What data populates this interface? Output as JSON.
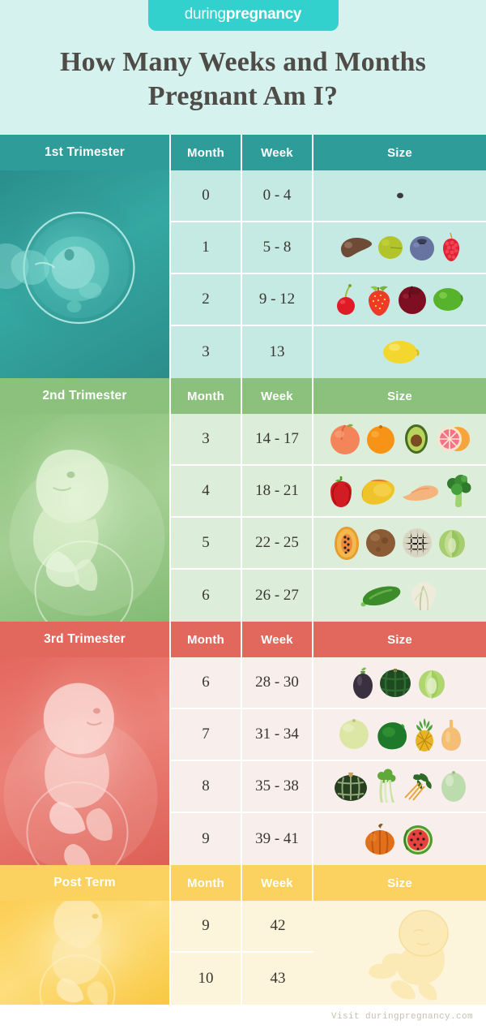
{
  "brand": {
    "logo_light": "during",
    "logo_bold": "pregnancy",
    "badge_color": "#33D1CD"
  },
  "title": "How Many Weeks and Months Pregnant Am I?",
  "columns": {
    "month": "Month",
    "week": "Week",
    "size": "Size"
  },
  "footer": {
    "text": "Visit duringpregnancy.com"
  },
  "sections": [
    {
      "name": "1st Trimester",
      "header_color": "#2E9D99",
      "body_color": "#C5E9E3",
      "image": "embryo-illustration-teal",
      "rows": [
        {
          "month": "0",
          "week": "0 - 4",
          "sizes": [
            "poppy-seed"
          ]
        },
        {
          "month": "1",
          "week": "5 - 8",
          "sizes": [
            "fig",
            "olive",
            "blueberry",
            "raspberry"
          ]
        },
        {
          "month": "2",
          "week": "9 - 12",
          "sizes": [
            "cherry",
            "strawberry",
            "plum",
            "lime"
          ]
        },
        {
          "month": "3",
          "week": "13",
          "sizes": [
            "lemon"
          ]
        }
      ]
    },
    {
      "name": "2nd Trimester",
      "header_color": "#8BC17C",
      "body_color": "#DCEEDA",
      "image": "fetus-illustration-green",
      "rows": [
        {
          "month": "3",
          "week": "14 - 17",
          "sizes": [
            "peach",
            "orange",
            "avocado",
            "grapefruit"
          ]
        },
        {
          "month": "4",
          "week": "18 - 21",
          "sizes": [
            "bell-pepper",
            "mango",
            "sweet-potato",
            "broccoli"
          ]
        },
        {
          "month": "5",
          "week": "22 - 25",
          "sizes": [
            "papaya",
            "coconut",
            "cantaloupe",
            "cabbage"
          ]
        },
        {
          "month": "6",
          "week": "26 - 27",
          "sizes": [
            "zucchini",
            "cauliflower"
          ]
        }
      ]
    },
    {
      "name": "3rd Trimester",
      "header_color": "#E2685E",
      "body_color": "#F8EEEC",
      "image": "fetus-illustration-red",
      "rows": [
        {
          "month": "6",
          "week": "28 - 30",
          "sizes": [
            "eggplant",
            "acorn-squash",
            "napa-cabbage"
          ]
        },
        {
          "month": "7",
          "week": "31 - 34",
          "sizes": [
            "honeydew",
            "squash",
            "pineapple",
            "butternut-squash"
          ]
        },
        {
          "month": "8",
          "week": "35 - 38",
          "sizes": [
            "kabocha-squash",
            "celery",
            "swiss-chard",
            "winter-melon"
          ]
        },
        {
          "month": "9",
          "week": "39 - 41",
          "sizes": [
            "pumpkin",
            "watermelon"
          ]
        }
      ]
    },
    {
      "name": "Post Term",
      "header_color": "#FBD25F",
      "body_color": "#FDF4DC",
      "image": "newborn-illustration-yellow",
      "size_image": "newborn-outline",
      "rows": [
        {
          "month": "9",
          "week": "42",
          "sizes": []
        },
        {
          "month": "10",
          "week": "43",
          "sizes": []
        }
      ]
    }
  ]
}
